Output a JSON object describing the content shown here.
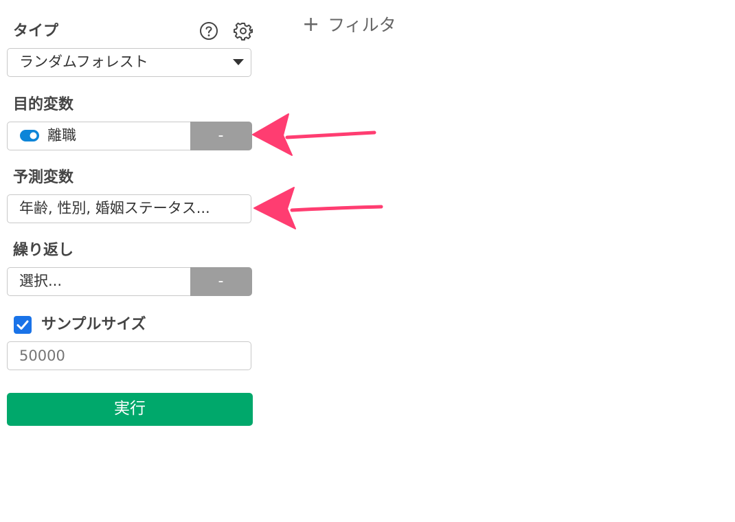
{
  "type_section": {
    "label": "タイプ",
    "selected": "ランダムフォレスト",
    "help_icon": "help-circle-icon",
    "settings_icon": "gear-icon"
  },
  "filter": {
    "plus": "+",
    "label": "フィルタ"
  },
  "target": {
    "label": "目的変数",
    "value": "離職",
    "button": "-",
    "toggle_on": true
  },
  "predictors": {
    "label": "予測変数",
    "value": "年齢, 性別, 婚姻ステータス..."
  },
  "repeat": {
    "label": "繰り返し",
    "placeholder": "選択...",
    "button": "-"
  },
  "sample": {
    "checked": true,
    "label": "サンプルサイズ",
    "placeholder": "50000"
  },
  "run": {
    "label": "実行"
  },
  "colors": {
    "run_button": "#00a86b",
    "grey_button": "#9e9e9e",
    "toggle": "#0d85d8",
    "checkbox": "#1a73e8",
    "arrow": "#ff3d71"
  }
}
